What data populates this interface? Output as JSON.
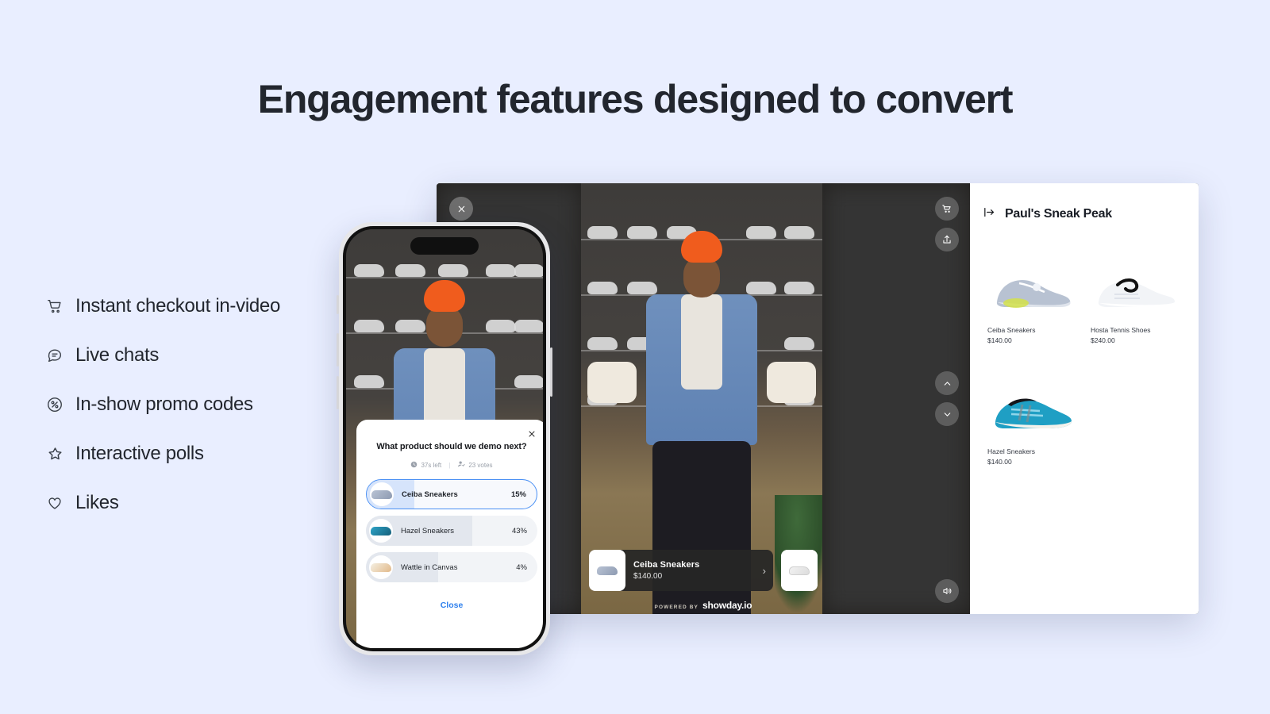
{
  "page": {
    "headline": "Engagement features designed to convert",
    "background_color": "#e9eeff"
  },
  "features": [
    {
      "icon": "shopping-cart-icon",
      "label": "Instant checkout in-video"
    },
    {
      "icon": "chat-bubble-icon",
      "label": "Live chats"
    },
    {
      "icon": "percent-circle-icon",
      "label": "In-show promo codes"
    },
    {
      "icon": "star-icon",
      "label": "Interactive polls"
    },
    {
      "icon": "heart-icon",
      "label": "Likes"
    }
  ],
  "player": {
    "controls": {
      "close": "close-icon",
      "cart": "cart-icon",
      "share": "share-icon",
      "prev": "chevron-up-icon",
      "next": "chevron-down-icon",
      "sound": "speaker-icon"
    },
    "product_card": {
      "name": "Ceiba Sneakers",
      "price": "$140.00",
      "chevron": "›"
    },
    "powered_by": {
      "label": "POWERED BY",
      "brand": "showday.io"
    }
  },
  "panel": {
    "collapse_icon": "collapse-panel-icon",
    "title": "Paul's Sneak Peak",
    "products": [
      {
        "name": "Ceiba Sneakers",
        "price": "$140.00"
      },
      {
        "name": "Hosta Tennis Shoes",
        "price": "$240.00"
      },
      {
        "name": "Hazel Sneakers",
        "price": "$140.00"
      }
    ]
  },
  "poll": {
    "close_icon": "close-icon",
    "question": "What product should we demo next?",
    "time_left": "37s left",
    "time_icon": "clock-icon",
    "votes": "23 votes",
    "votes_icon": "voter-icon",
    "separator": "|",
    "options": [
      {
        "label": "Ceiba Sneakers",
        "percent": "15%",
        "value": 15,
        "selected": true
      },
      {
        "label": "Hazel Sneakers",
        "percent": "43%",
        "value": 43,
        "selected": false
      },
      {
        "label": "Wattle in Canvas",
        "percent": "4%",
        "value": 4,
        "selected": false
      }
    ],
    "close_label": "Close",
    "accent_color": "#4a90f4"
  }
}
